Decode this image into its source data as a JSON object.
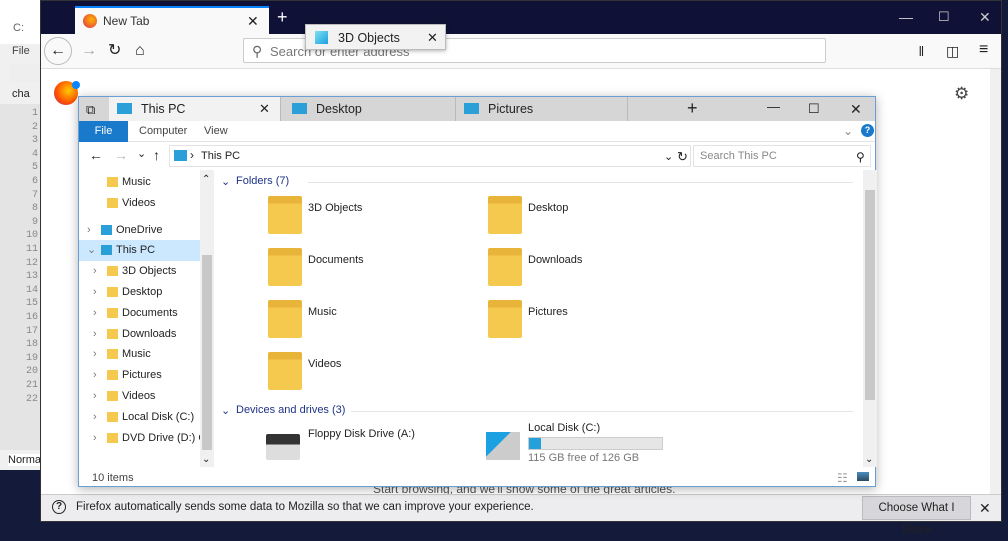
{
  "notepad": {
    "menu_file": "File",
    "status": "Norma",
    "tab": "cha",
    "title_frag": "C:",
    "lines": [
      "1",
      "2",
      "3",
      "4",
      "5",
      "6",
      "7",
      "8",
      "9",
      "10",
      "11",
      "12",
      "13",
      "14",
      "15",
      "16",
      "17",
      "18",
      "19",
      "20",
      "21",
      "22"
    ]
  },
  "firefox": {
    "tab_title": "New Tab",
    "url_placeholder": "Search or enter address",
    "dragged_tab": "3D Objects",
    "body_text": "Start browsing, and we'll show some of the great articles.",
    "notification": {
      "text": "Firefox automatically sends some data to Mozilla so that we can improve your experience.",
      "button": "Choose What I Share"
    }
  },
  "explorer": {
    "tabs": [
      {
        "label": "This PC",
        "icon": "computer-icon"
      },
      {
        "label": "Desktop",
        "icon": "desktop-icon"
      },
      {
        "label": "Pictures",
        "icon": "pictures-icon"
      }
    ],
    "ribbon": {
      "file": "File",
      "computer": "Computer",
      "view": "View"
    },
    "address": "This PC",
    "search_placeholder": "Search This PC",
    "nav": [
      {
        "label": "Music",
        "level": 2,
        "expander": ""
      },
      {
        "label": "Videos",
        "level": 2,
        "expander": ""
      },
      {
        "label": "OneDrive",
        "level": 1,
        "expander": "›"
      },
      {
        "label": "This PC",
        "level": 1,
        "expander": "⌄",
        "selected": true
      },
      {
        "label": "3D Objects",
        "level": 2,
        "expander": "›"
      },
      {
        "label": "Desktop",
        "level": 2,
        "expander": "›"
      },
      {
        "label": "Documents",
        "level": 2,
        "expander": "›"
      },
      {
        "label": "Downloads",
        "level": 2,
        "expander": "›"
      },
      {
        "label": "Music",
        "level": 2,
        "expander": "›"
      },
      {
        "label": "Pictures",
        "level": 2,
        "expander": "›"
      },
      {
        "label": "Videos",
        "level": 2,
        "expander": "›"
      },
      {
        "label": "Local Disk (C:)",
        "level": 2,
        "expander": "›"
      },
      {
        "label": "DVD Drive (D:) CC",
        "level": 2,
        "expander": "›"
      }
    ],
    "folders_header": "Folders (7)",
    "folders": [
      "3D Objects",
      "Desktop",
      "Documents",
      "Downloads",
      "Music",
      "Pictures",
      "Videos"
    ],
    "devices_header": "Devices and drives (3)",
    "drives": [
      {
        "label": "Floppy Disk Drive (A:)"
      },
      {
        "label": "Local Disk (C:)",
        "free": "115 GB free of 126 GB",
        "used_fraction": 0.087
      }
    ],
    "status": "10 items",
    "colors": {
      "accent": "#1979ca",
      "selected": "#cce8ff",
      "folder": "#f4c94e"
    }
  }
}
